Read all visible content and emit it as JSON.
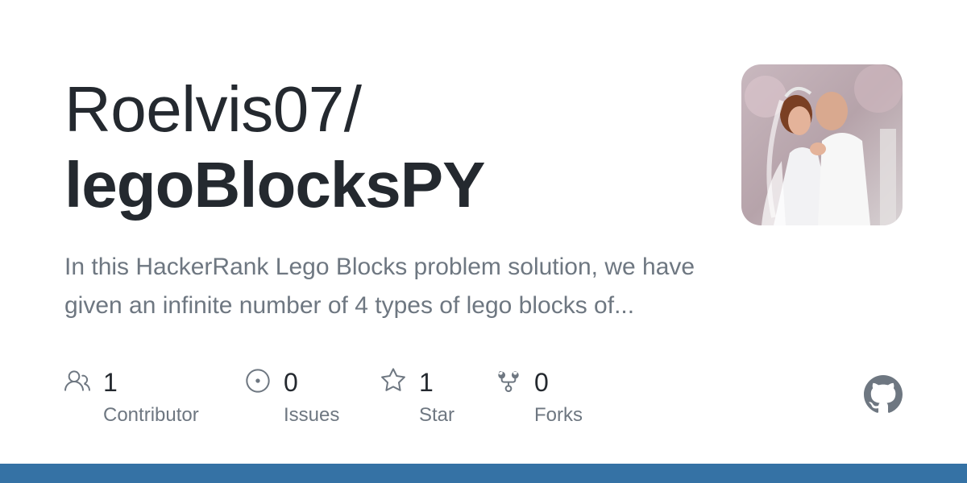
{
  "repo": {
    "owner": "Roelvis07/",
    "name": "legoBlocksPY",
    "description": "In this HackerRank Lego Blocks problem solution, we have given an infinite number of 4 types of lego blocks of..."
  },
  "stats": [
    {
      "icon": "people-icon",
      "count": "1",
      "label": "Contributor"
    },
    {
      "icon": "issue-opened-icon",
      "count": "0",
      "label": "Issues"
    },
    {
      "icon": "star-icon",
      "count": "1",
      "label": "Star"
    },
    {
      "icon": "repo-forked-icon",
      "count": "0",
      "label": "Forks"
    }
  ],
  "colors": {
    "text_primary": "#24292f",
    "text_secondary": "#6e7781",
    "language_bar": "#3572a5",
    "github_logo": "#6e7781"
  },
  "logo": {
    "icon": "github-mark-icon"
  }
}
